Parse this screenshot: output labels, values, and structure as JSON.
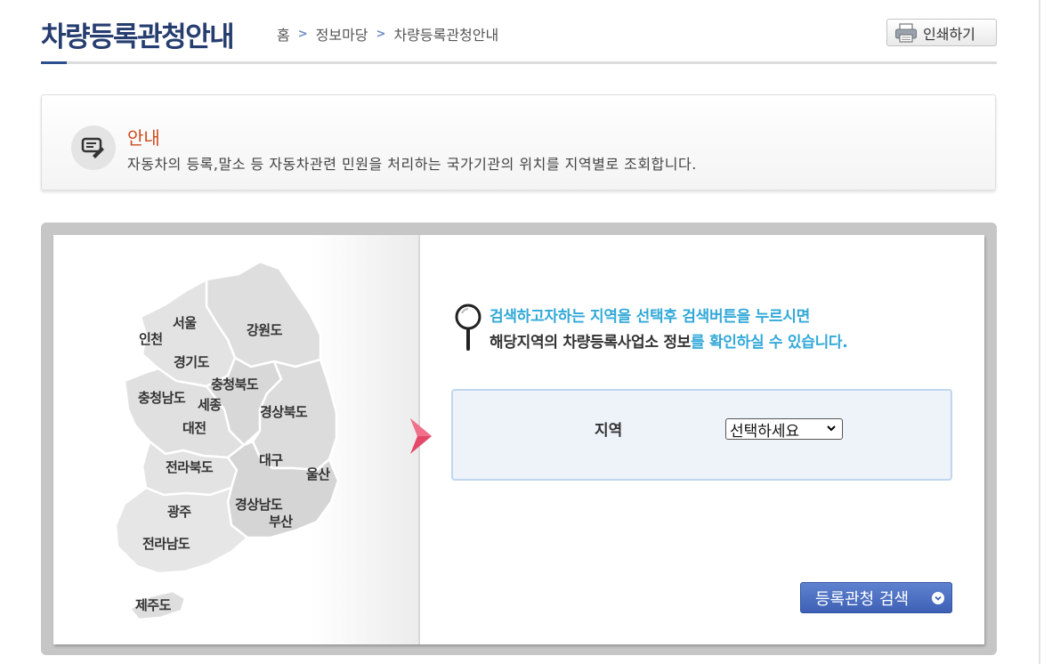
{
  "page": {
    "title": "차량등록관청안내",
    "print_label": "인쇄하기"
  },
  "breadcrumb": [
    "홈",
    "정보마당",
    "차량등록관청안내"
  ],
  "notice": {
    "title": "안내",
    "text": "자동차의 등록,말소 등 자동차관련 민원을 처리하는 국가기관의 위치를 지역별로 조회합니다."
  },
  "map": {
    "regions": {
      "seoul": "서울",
      "incheon": "인천",
      "gangwon": "강원도",
      "gyeonggi": "경기도",
      "chungbuk": "충청북도",
      "chungnam": "충청남도",
      "sejong": "세종",
      "daejeon": "대전",
      "gyeongbuk": "경상북도",
      "jeonbuk": "전라북도",
      "daegu": "대구",
      "ulsan": "울산",
      "gwangju": "광주",
      "gyeongnam": "경상남도",
      "busan": "부산",
      "jeonnam": "전라남도",
      "jeju": "제주도"
    }
  },
  "guide": {
    "line1": "검색하고자하는 지역을 선택후 검색버튼을 누르시면",
    "line2_dark": "해당지역의 차량등록사업소 정보",
    "line2_blue": "를 확인하실 수 있습니다."
  },
  "search": {
    "region_label": "지역",
    "region_selected": "선택하세요",
    "button_label": "등록관청 검색"
  },
  "colors": {
    "title": "#263d70",
    "notice_title": "#d04a1c",
    "guide_blue": "#33a9d8",
    "button": "#4a6cc0",
    "arrow": "#e44868"
  }
}
